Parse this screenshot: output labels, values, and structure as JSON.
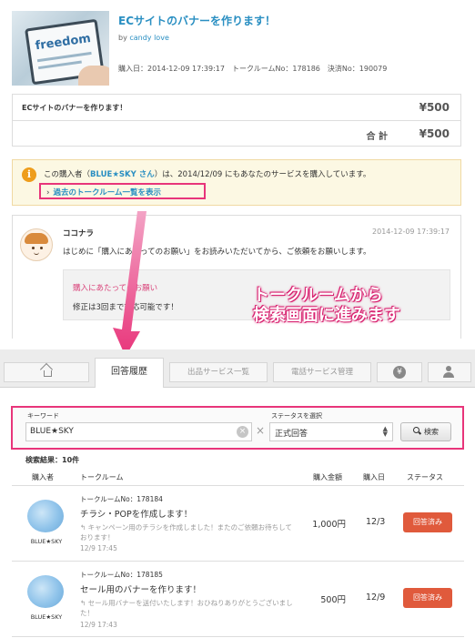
{
  "order_view": {
    "product": {
      "title": "ECサイトのバナーを作ります！",
      "thumbnail_word": "freedom",
      "by_prefix": "by",
      "seller": "candy love",
      "meta": "購入日：2014-12-09 17:39:17　トークルームNo：178186　決済No：190079"
    },
    "order": {
      "item_name": "ECサイトのバナーを作ります！",
      "item_price": "¥500",
      "total_label": "合 計",
      "total_price": "¥500"
    },
    "alert": {
      "msg_before": "この購入者（",
      "buyer": "BLUE★SKY さん",
      "msg_after": "）は、2014/12/09 にもあなたのサービスを購入しています。",
      "link_chevron": "›",
      "link_label": "過去のトークルーム一覧を表示"
    },
    "message": {
      "sender": "ココナラ",
      "time": "2014-12-09 17:39:17",
      "text": "はじめに「購入にあたってのお願い」をお読みいただいてから、ご依頼をお願いします。",
      "notice_title": "購入にあたってのお願い",
      "notice_text": "修正は3回まで対応可能です！"
    }
  },
  "annotation": {
    "line1": "トークルームから",
    "line2": "検索画面に進みます",
    "color": "#e8357a"
  },
  "search_view": {
    "tabs": [
      {
        "icon": "home-icon",
        "label": ""
      },
      {
        "label": "回答履歴"
      },
      {
        "label": "出品サービス一覧"
      },
      {
        "label": "電話サービス管理"
      },
      {
        "icon": "yen-icon",
        "label": "¥"
      },
      {
        "icon": "user-icon",
        "label": ""
      }
    ],
    "keyword_label": "キーワード",
    "keyword_value": "BLUE★SKY",
    "clear_glyph": "×",
    "separator": "×",
    "status_label": "ステータスを選択",
    "status_value": "正式回答",
    "search_button": "検索",
    "result_count": "検索結果：10件",
    "columns": [
      "購入者",
      "トークルーム",
      "購入金額",
      "購入日",
      "ステータス"
    ],
    "rows": [
      {
        "buyer": "BLUE★SKY",
        "room_no": "トークルームNo：178184",
        "title": "チラシ・POPを作成します！",
        "snippet": "↰ キャンペーン用のチラシを作成しました！またのご依頼お待ちしております！",
        "date_time": "12/9 17:45",
        "amount": "1,000円",
        "date": "12/3",
        "status": "回答済み"
      },
      {
        "buyer": "BLUE★SKY",
        "room_no": "トークルームNo：178185",
        "title": "セール用のバナーを作ります！",
        "snippet": "↰ セール用バナーを送付いたします！おひねりありがとうございました！",
        "date_time": "12/9 17:43",
        "amount": "500円",
        "date": "12/9",
        "status": "回答済み"
      }
    ]
  }
}
